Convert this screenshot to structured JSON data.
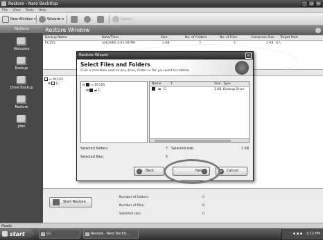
{
  "window": {
    "title": "Restore - Nero BackItUp",
    "minimize": "_",
    "restore": "▫",
    "close": "×"
  },
  "menu": [
    "File",
    "View",
    "Tools",
    "Help"
  ],
  "toolbar": {
    "new_window": "New Window",
    "wizards": "Wizards",
    "cancel": "Cancel"
  },
  "sidebar": {
    "header": "Options",
    "items": [
      {
        "label": "Welcome"
      },
      {
        "label": "Backup"
      },
      {
        "label": "Drive Backup"
      },
      {
        "label": "Restore"
      },
      {
        "label": "Jobs"
      }
    ]
  },
  "main": {
    "title": "Restore Window",
    "columns": [
      "Backup Name",
      "Date/Time",
      "Size",
      "No. of Folders",
      "No. of Files",
      "Compress Size",
      "Target Path"
    ],
    "row": {
      "name": "PC155",
      "datetime": "5/4/2005 2:01:59 PM",
      "size": "1 KB",
      "folders": "7",
      "files": "5",
      "compress": "2 KB",
      "target": "G:\\"
    },
    "tree": {
      "root": "PC155",
      "child": "C:"
    }
  },
  "bottom": {
    "start_restore": "Start Restore",
    "labels": [
      "Number of folders:",
      "Number of files:",
      "Selected size:"
    ],
    "values": [
      "0",
      "0",
      "0"
    ]
  },
  "status": "Ready",
  "taskbar": {
    "start": "start",
    "tasks": [
      "G:\\",
      "Restore - Nero BackIt..."
    ],
    "clock": "2:12 PM"
  },
  "dialog": {
    "title": "Restore Wizard",
    "heading": "Select Files and Folders",
    "subtitle": "Click a checkbox next to any drive, folder or file you want to restore.",
    "tree": {
      "root": "PC155",
      "child": "C:"
    },
    "list_columns": [
      "Name",
      "Size",
      "Type"
    ],
    "list_row": {
      "name": "C:",
      "size": "1 KB",
      "type": "Backup Drive"
    },
    "summary": {
      "sel_folders_label": "Selected folders:",
      "sel_folders_value": "7",
      "sel_size_label": "Selected size:",
      "sel_size_value": "1 KB",
      "sel_files_label": "Selected files:",
      "sel_files_value": "5"
    },
    "buttons": {
      "back": "Back",
      "next": "Next",
      "cancel": "Cancel"
    }
  }
}
